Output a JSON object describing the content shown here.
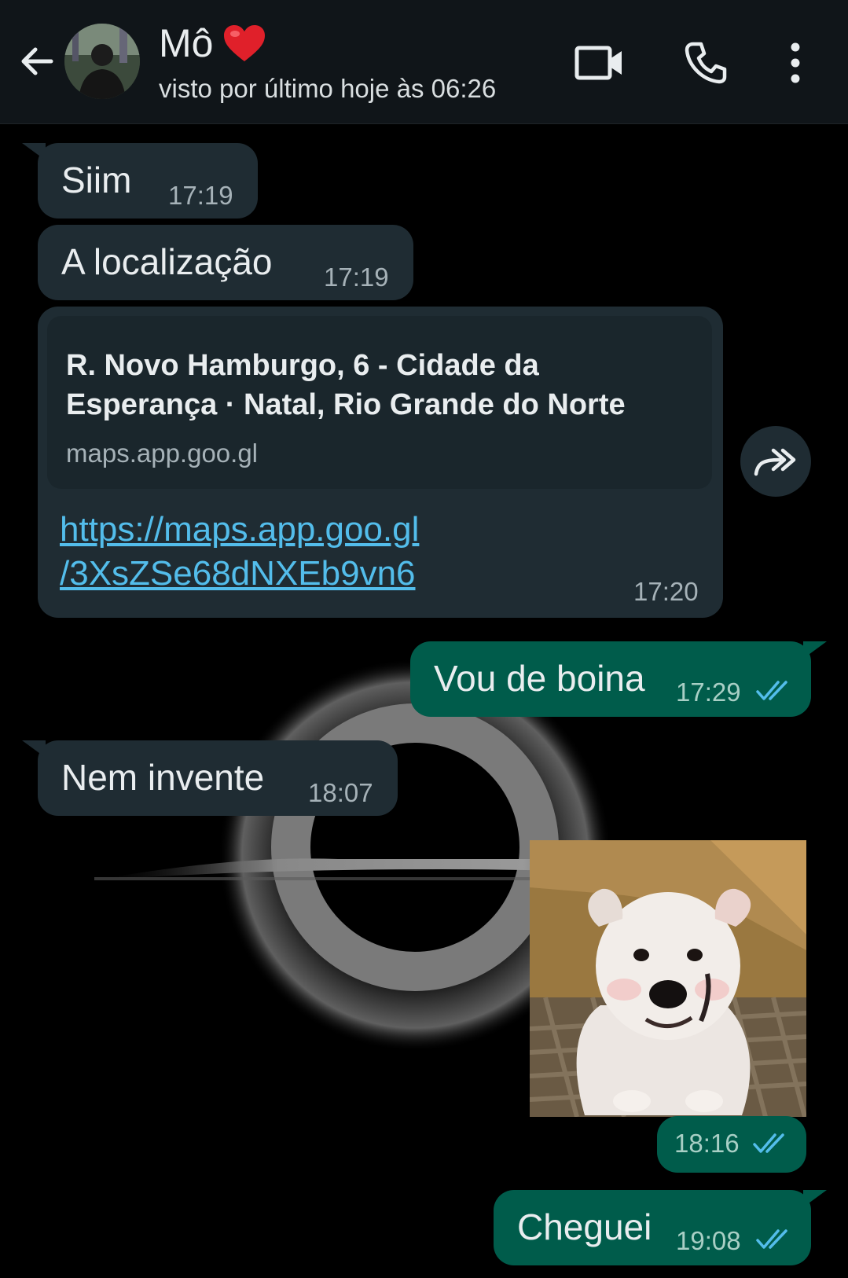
{
  "header": {
    "contact_name": "Mô",
    "status": "visto por último hoje às 06:26",
    "icons": {
      "back": "arrow-left-icon",
      "video": "video-camera-icon",
      "call": "phone-icon",
      "menu": "more-vertical-icon",
      "heart": "red-heart-emoji"
    }
  },
  "messages": [
    {
      "direction": "in",
      "text": "Siim",
      "time": "17:19"
    },
    {
      "direction": "in",
      "text": "A localização",
      "time": "17:19"
    },
    {
      "direction": "in",
      "link_preview": {
        "title": "R. Novo Hamburgo, 6 - Cidade da Esperança · Natal, Rio Grande do Norte",
        "domain": "maps.app.goo.gl"
      },
      "url_line1": "https://maps.app.goo.gl",
      "url_line2": "/3XsZSe68dNXEb9vn6",
      "time": "17:20"
    },
    {
      "direction": "out",
      "text": "Vou de boina",
      "time": "17:29",
      "status": "read"
    },
    {
      "direction": "in",
      "text": "Nem invente",
      "time": "18:07"
    },
    {
      "direction": "out",
      "type": "image",
      "image_subject": "white puppy sitting on a woven mat",
      "time": "18:16",
      "status": "read"
    },
    {
      "direction": "out",
      "text": "Cheguei",
      "time": "19:08",
      "status": "read"
    }
  ],
  "colors": {
    "header_bg": "#101519",
    "incoming_bubble": "#1f2c33",
    "outgoing_bubble": "#005c4b",
    "link": "#53bdeb",
    "read_ticks": "#53bdeb"
  }
}
